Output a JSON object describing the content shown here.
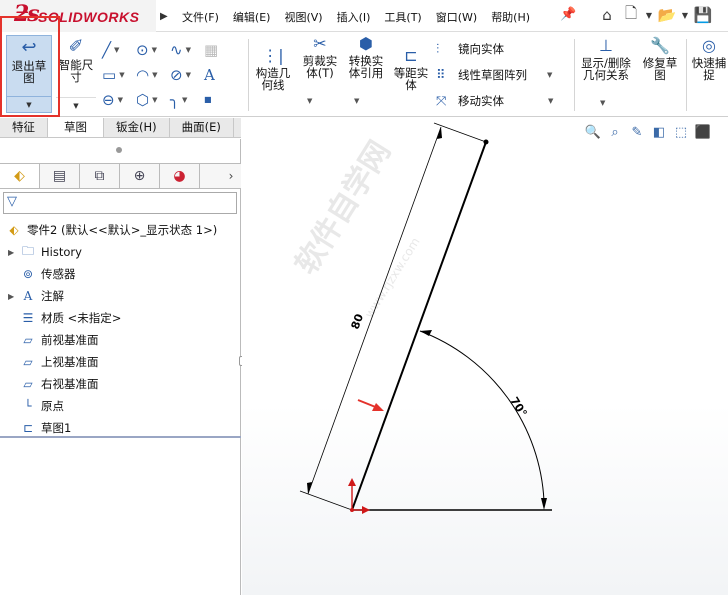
{
  "app": {
    "logo_prefix": "ƻs",
    "logo_name": "SOLIDWORKS"
  },
  "menu": [
    "文件(F)",
    "编辑(E)",
    "视图(V)",
    "插入(I)",
    "工具(T)",
    "窗口(W)",
    "帮助(H)"
  ],
  "toolbar": {
    "exit_sketch": "退出草图",
    "smart_dim": "智能尺寸",
    "construct_geom": "构造几何线",
    "trim": "剪裁实体(T)",
    "convert": "转换实体引用",
    "offset": "等距实体",
    "mirror": "镜向实体",
    "linear_pattern": "线性草图阵列",
    "move": "移动实体",
    "display_relations": "显示/删除几何关系",
    "repair_sketch": "修复草图",
    "quick_snap": "快速捕捉"
  },
  "tabs": [
    "特征",
    "草图",
    "钣金(H)",
    "曲面(E)"
  ],
  "tree": {
    "root": "零件2 (默认<<默认>_显示状态 1>)",
    "items": [
      {
        "label": "History",
        "expandable": true,
        "icon": "history-icon"
      },
      {
        "label": "传感器",
        "expandable": false,
        "icon": "sensor-icon"
      },
      {
        "label": "注解",
        "expandable": true,
        "icon": "annotation-icon"
      },
      {
        "label": "材质 <未指定>",
        "expandable": false,
        "icon": "material-icon"
      },
      {
        "label": "前视基准面",
        "expandable": false,
        "icon": "plane-icon"
      },
      {
        "label": "上视基准面",
        "expandable": false,
        "icon": "plane-icon"
      },
      {
        "label": "右视基准面",
        "expandable": false,
        "icon": "plane-icon"
      },
      {
        "label": "原点",
        "expandable": false,
        "icon": "origin-icon"
      },
      {
        "label": "草图1",
        "expandable": false,
        "icon": "sketch-icon"
      }
    ]
  },
  "sketch": {
    "length_dim": "80",
    "angle_dim": "70°"
  },
  "watermark": {
    "text": "软件自学网",
    "url": "www.rjzxw.com"
  },
  "colors": {
    "accent": "#2a5ea8",
    "highlight_box": "#e4322b",
    "pressed_button": "#c9dcf0",
    "brand_red": "#c8102e"
  }
}
